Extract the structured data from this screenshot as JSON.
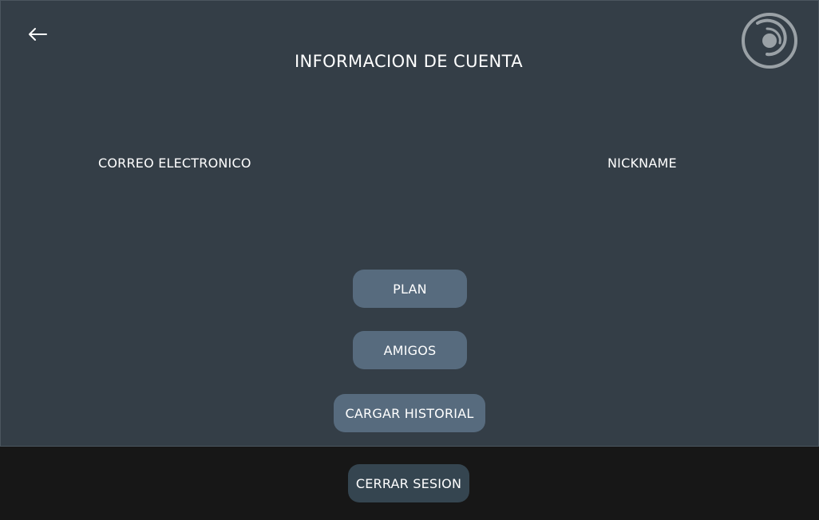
{
  "header": {
    "title": "INFORMACION DE CUENTA",
    "back_icon": "arrow-left-icon",
    "logo_icon": "spiral-logo-icon"
  },
  "account": {
    "email_label": "CORREO ELECTRONICO",
    "nickname_label": "NICKNAME"
  },
  "actions": {
    "plan_label": "PLAN",
    "friends_label": "AMIGOS",
    "load_history_label": "CARGAR HISTORIAL"
  },
  "footer": {
    "logout_label": "CERRAR SESION"
  },
  "colors": {
    "panel_background": "#343e47",
    "footer_background": "#171717",
    "button_background": "#576b7e",
    "logout_button_background": "#354550",
    "text": "#ffffff",
    "logo": "#9aa1a6"
  }
}
